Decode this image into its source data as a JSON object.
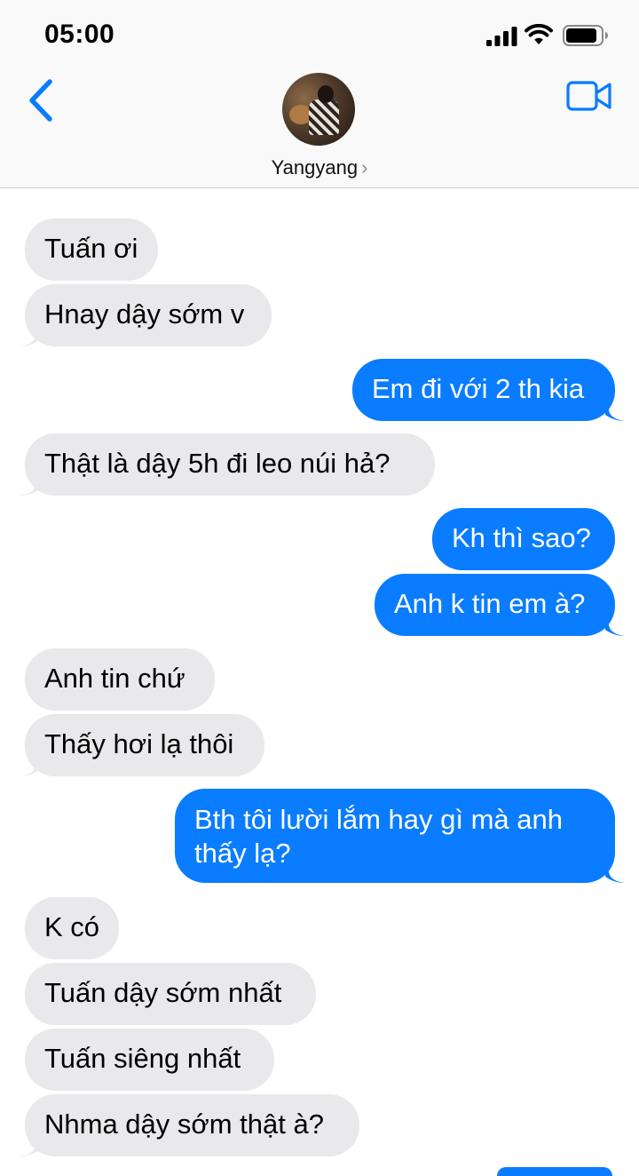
{
  "status_bar": {
    "time": "05:00"
  },
  "header": {
    "contact_name": "Yangyang",
    "chevron": "›",
    "back_icon": "chevron-left-icon",
    "video_icon": "video-camera-icon"
  },
  "colors": {
    "sent_bubble": "#0a7cff",
    "received_bubble": "#e9e9eb",
    "accent": "#0a7cff"
  },
  "messages": [
    {
      "direction": "received",
      "text": "Tuấn ơi"
    },
    {
      "direction": "received",
      "text": "Hnay dậy sớm v"
    },
    {
      "direction": "sent",
      "text": "Em đi với 2 th kia"
    },
    {
      "direction": "received",
      "text": "Thật là dậy 5h đi leo núi hả?"
    },
    {
      "direction": "sent",
      "text": "Kh thì sao?"
    },
    {
      "direction": "sent",
      "text": "Anh k tin em à?"
    },
    {
      "direction": "received",
      "text": "Anh tin chứ"
    },
    {
      "direction": "received",
      "text": "Thấy hơi lạ thôi"
    },
    {
      "direction": "sent",
      "text": "Bth tôi lười lắm hay gì mà anh thấy lạ?"
    },
    {
      "direction": "received",
      "text": "K có"
    },
    {
      "direction": "received",
      "text": "Tuấn dậy sớm nhất"
    },
    {
      "direction": "received",
      "text": "Tuấn siêng nhất"
    },
    {
      "direction": "received",
      "text": "Nhma dậy sớm thật à?"
    }
  ]
}
